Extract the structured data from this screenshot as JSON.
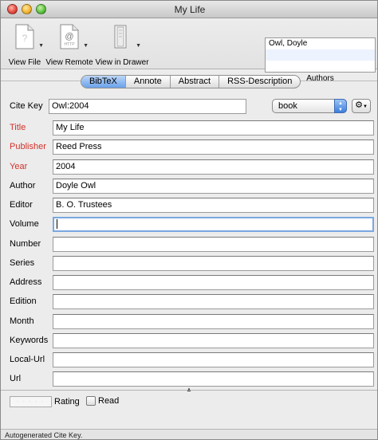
{
  "window": {
    "title": "My Life"
  },
  "toolbar": {
    "view_file": "View File",
    "view_remote": "View Remote",
    "view_drawer": "View in Drawer",
    "remote_icon_text": "@",
    "remote_icon_sub": "HTTP"
  },
  "authors": {
    "label": "Authors",
    "items": [
      "Owl, Doyle"
    ]
  },
  "tabs": [
    "BibTeX",
    "Annote",
    "Abstract",
    "RSS-Description"
  ],
  "form": {
    "cite_key_label": "Cite Key",
    "cite_key_value": "Owl:2004",
    "type_value": "book",
    "fields": [
      {
        "label": "Title",
        "value": "My Life"
      },
      {
        "label": "Publisher",
        "value": "Reed Press"
      },
      {
        "label": "Year",
        "value": "2004"
      },
      {
        "label": "Author",
        "value": "Doyle Owl"
      },
      {
        "label": "Editor",
        "value": "B. O. Trustees"
      },
      {
        "label": "Volume",
        "value": ""
      },
      {
        "label": "Number",
        "value": ""
      },
      {
        "label": "Series",
        "value": ""
      },
      {
        "label": "Address",
        "value": ""
      },
      {
        "label": "Edition",
        "value": ""
      },
      {
        "label": "Month",
        "value": ""
      },
      {
        "label": "Keywords",
        "value": ""
      },
      {
        "label": "Local-Url",
        "value": ""
      },
      {
        "label": "Url",
        "value": ""
      }
    ]
  },
  "bottom": {
    "rating_label": "Rating",
    "rating_value": 0,
    "read_label": "Read"
  },
  "status": {
    "text": "Autogenerated Cite Key."
  },
  "colors": {
    "required_label": "#d3312a",
    "selected_tab": "#6aa2ea",
    "focus_ring": "#7aa7e0"
  }
}
